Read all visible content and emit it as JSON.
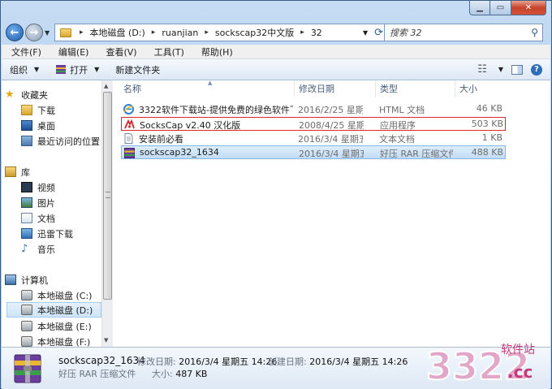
{
  "address": {
    "crumbs": [
      "本地磁盘 (D:)",
      "ruanjian",
      "sockscap32中文版",
      "32"
    ]
  },
  "search": {
    "placeholder": "搜索 32"
  },
  "menu": [
    "文件(F)",
    "编辑(E)",
    "查看(V)",
    "工具(T)",
    "帮助(H)"
  ],
  "toolbar": {
    "organize": "组织",
    "open": "打开",
    "new_folder": "新建文件夹"
  },
  "sidebar": {
    "favorites": {
      "label": "收藏夹",
      "items": [
        "下载",
        "桌面",
        "最近访问的位置"
      ]
    },
    "libraries": {
      "label": "库",
      "items": [
        "视频",
        "图片",
        "文档",
        "迅雷下载",
        "音乐"
      ]
    },
    "computer": {
      "label": "计算机",
      "items": [
        "本地磁盘 (C:)",
        "本地磁盘 (D:)",
        "本地磁盘 (E:)",
        "本地磁盘 (F:)"
      ]
    }
  },
  "columns": {
    "name": "名称",
    "date": "修改日期",
    "type": "类型",
    "size": "大小"
  },
  "files": [
    {
      "name": "3322软件下载站-提供免费的绿色软件下...",
      "date": "2016/2/25 星期...",
      "type": "HTML 文档",
      "size": "46 KB",
      "icon": "ie-icon"
    },
    {
      "name": "SocksCap v2.40 汉化版",
      "date": "2008/4/25 星期...",
      "type": "应用程序",
      "size": "503 KB",
      "icon": "app-icon"
    },
    {
      "name": "安装前必看",
      "date": "2016/3/4 星期五 ...",
      "type": "文本文档",
      "size": "1 KB",
      "icon": "text-file-icon"
    },
    {
      "name": "sockscap32_1634",
      "date": "2016/3/4 星期五 ...",
      "type": "好压 RAR 压缩文件",
      "size": "488 KB",
      "icon": "rar-icon"
    }
  ],
  "details": {
    "name": "sockscap32_1634",
    "modified_label": "修改日期:",
    "modified": "2016/3/4 星期五 14:26",
    "created_label": "创建日期:",
    "created": "2016/3/4 星期五 14:26",
    "type": "好压 RAR 压缩文件",
    "size_label": "大小:",
    "size": "487 KB"
  },
  "watermark": {
    "number": "3322",
    "site": "软件站",
    "domain": ".cc"
  }
}
